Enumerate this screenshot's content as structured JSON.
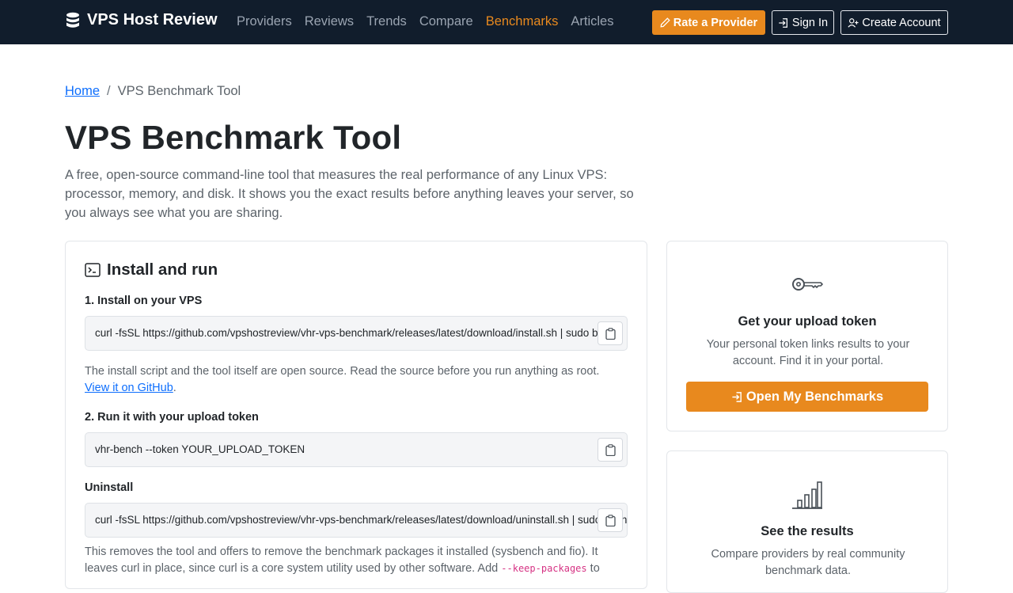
{
  "nav": {
    "brand": "VPS Host Review",
    "links": [
      "Providers",
      "Reviews",
      "Trends",
      "Compare",
      "Benchmarks",
      "Articles"
    ],
    "active": "Benchmarks",
    "rate_label": "Rate a Provider",
    "signin_label": "Sign In",
    "create_label": "Create Account"
  },
  "breadcrumb": {
    "home": "Home",
    "separator": "/",
    "current": "VPS Benchmark Tool"
  },
  "header": {
    "title": "VPS Benchmark Tool",
    "lead": "A free, open-source command-line tool that measures the real performance of any Linux VPS: processor, memory, and disk. It shows you the exact results before anything leaves your server, so you always see what you are sharing."
  },
  "install": {
    "heading": "Install and run",
    "step1_label": "1. Install on your VPS",
    "step1_command": "curl -fsSL https://github.com/vpshostreview/vhr-vps-benchmark/releases/latest/download/install.sh | sudo bash",
    "step1_note": "The install script and the tool itself are open source. Read the source before you run anything as root.",
    "github_link": "View it on GitHub",
    "step1_note_end": ".",
    "step2_label": "2. Run it with your upload token",
    "step2_command": "vhr-bench --token YOUR_UPLOAD_TOKEN",
    "uninstall_label": "Uninstall",
    "uninstall_command": "curl -fsSL https://github.com/vpshostreview/vhr-vps-benchmark/releases/latest/download/uninstall.sh | sudo bash",
    "uninstall_note_a": "This removes the tool and offers to remove the benchmark packages it installed (sysbench and fio). It leaves curl in place, since curl is a core system utility used by other software. Add ",
    "uninstall_note_code": "--keep-packages",
    "uninstall_note_b": " to"
  },
  "token_card": {
    "title": "Get your upload token",
    "text": "Your personal token links results to your account. Find it in your portal.",
    "button": "Open My Benchmarks"
  },
  "results_card": {
    "title": "See the results",
    "text": "Compare providers by real community benchmark data."
  },
  "colors": {
    "navbar": "#111d2c",
    "accent": "#e8891e",
    "link": "#0d6efd"
  },
  "icons": [
    "database-icon",
    "pencil-icon",
    "sign-in-icon",
    "person-plus-icon",
    "terminal-icon",
    "clipboard-icon",
    "key-icon",
    "bar-chart-icon"
  ]
}
